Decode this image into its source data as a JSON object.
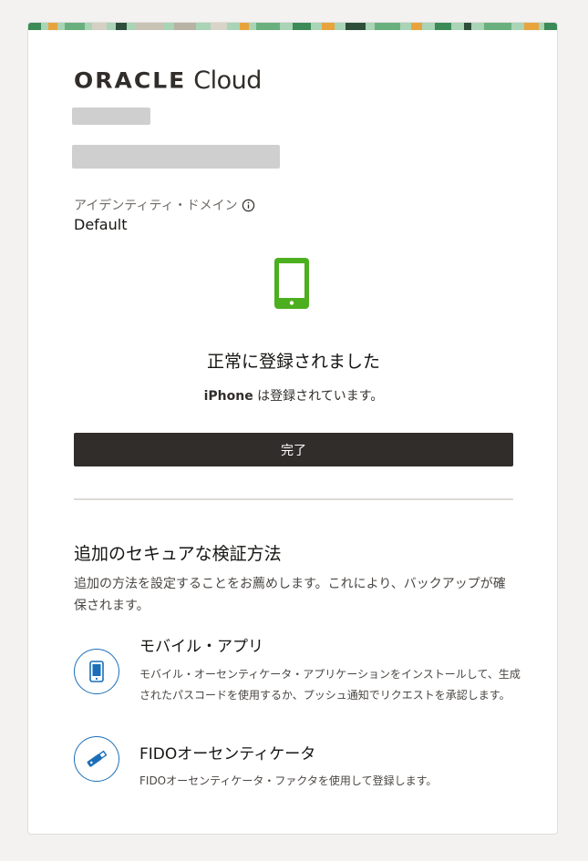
{
  "brand": {
    "oracle": "ORACLE",
    "cloud": "Cloud"
  },
  "identity_domain": {
    "label": "アイデンティティ・ドメイン",
    "value": "Default"
  },
  "success": {
    "title": "正常に登録されました",
    "device_name": "iPhone",
    "device_suffix": " は登録されています。"
  },
  "done_button": {
    "label": "完了"
  },
  "additional": {
    "title": "追加のセキュアな検証方法",
    "description": "追加の方法を設定することをお薦めします。これにより、バックアップが確保されます。",
    "methods": [
      {
        "icon": "mobile-phone-icon",
        "title": "モバイル・アプリ",
        "description": "モバイル・オーセンティケータ・アプリケーションをインストールして、生成されたパスコードを使用するか、プッシュ通知でリクエストを承認します。"
      },
      {
        "icon": "security-key-icon",
        "title": "FIDOオーセンティケータ",
        "description": "FIDOオーセンティケータ・ファクタを使用して登録します。"
      }
    ]
  },
  "colors": {
    "accent_green": "#4caf1f",
    "accent_blue": "#1a6fb8",
    "button_bg": "#312d2a",
    "page_bg": "#f3f2f1"
  }
}
